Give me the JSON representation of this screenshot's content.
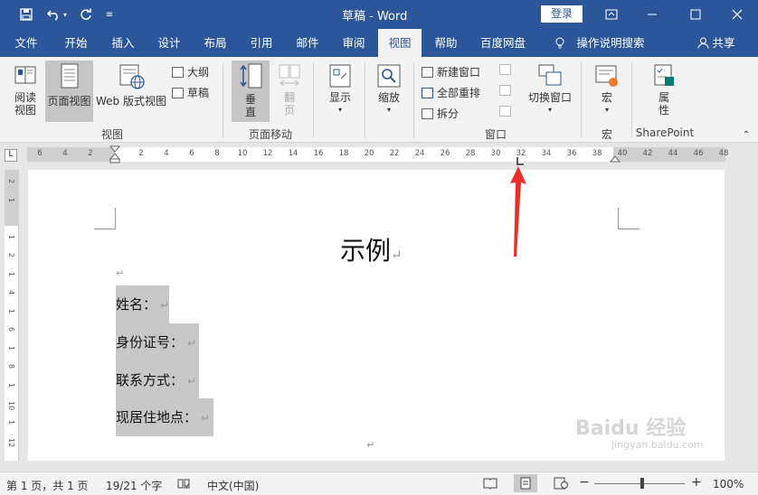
{
  "titlebar": {
    "title": "草稿 - Word",
    "login": "登录",
    "save_icon": "save-icon",
    "undo_icon": "undo-icon",
    "redo_icon": "redo-icon"
  },
  "tabs": [
    "文件",
    "开始",
    "插入",
    "设计",
    "布局",
    "引用",
    "邮件",
    "审阅",
    "视图",
    "帮助",
    "百度网盘",
    "操作说明搜索",
    "共享"
  ],
  "active_tab": "视图",
  "ribbon": {
    "views": {
      "read_mode_1": "阅读",
      "read_mode_2": "视图",
      "print_layout": "页面视图",
      "web_layout": "Web 版式视图",
      "outline": "大纲",
      "draft": "草稿",
      "group": "视图"
    },
    "page_move": {
      "vertical_1": "垂",
      "vertical_2": "直",
      "side_1": "翻",
      "side_2": "页",
      "group": "页面移动"
    },
    "show": {
      "label": "显示"
    },
    "zoom": {
      "label": "缩放"
    },
    "window": {
      "new_window": "新建窗口",
      "arrange_all": "全部重排",
      "split": "拆分",
      "switch_window": "切换窗口",
      "group": "窗口"
    },
    "macros": {
      "label": "宏",
      "group": "宏"
    },
    "sharepoint": {
      "properties_1": "属",
      "properties_2": "性",
      "group": "SharePoint"
    }
  },
  "ruler": {
    "corner": "L",
    "ticks": [
      "6",
      "4",
      "2",
      "",
      "2",
      "4",
      "6",
      "8",
      "10",
      "12",
      "14",
      "16",
      "18",
      "20",
      "22",
      "24",
      "26",
      "28",
      "30",
      "32",
      "34",
      "36",
      "38",
      "40",
      "42",
      "44",
      "46",
      "48"
    ]
  },
  "vruler_ticks": [
    "2",
    "1",
    "",
    "1",
    "2",
    "1",
    "4",
    "1",
    "6",
    "1",
    "8",
    "1",
    "10",
    "1",
    "12"
  ],
  "document": {
    "title": "示例",
    "para_mark": "↵",
    "lines": [
      "姓名：",
      "身份证号：",
      "联系方式：",
      "现居住地点："
    ]
  },
  "statusbar": {
    "page": "第 1 页，共 1 页",
    "words": "19/21 个字",
    "language": "中文(中国)",
    "zoom": "100%",
    "zoom_level_fraction": 0.5
  },
  "watermark": {
    "brand": "Baidu 经验",
    "url": "jingyan.baidu.com"
  },
  "colors": {
    "accent": "#2b579a",
    "selection": "#c8c8c8",
    "ribbon_bg": "#f3f3f3",
    "arrow": "#e8302a"
  }
}
